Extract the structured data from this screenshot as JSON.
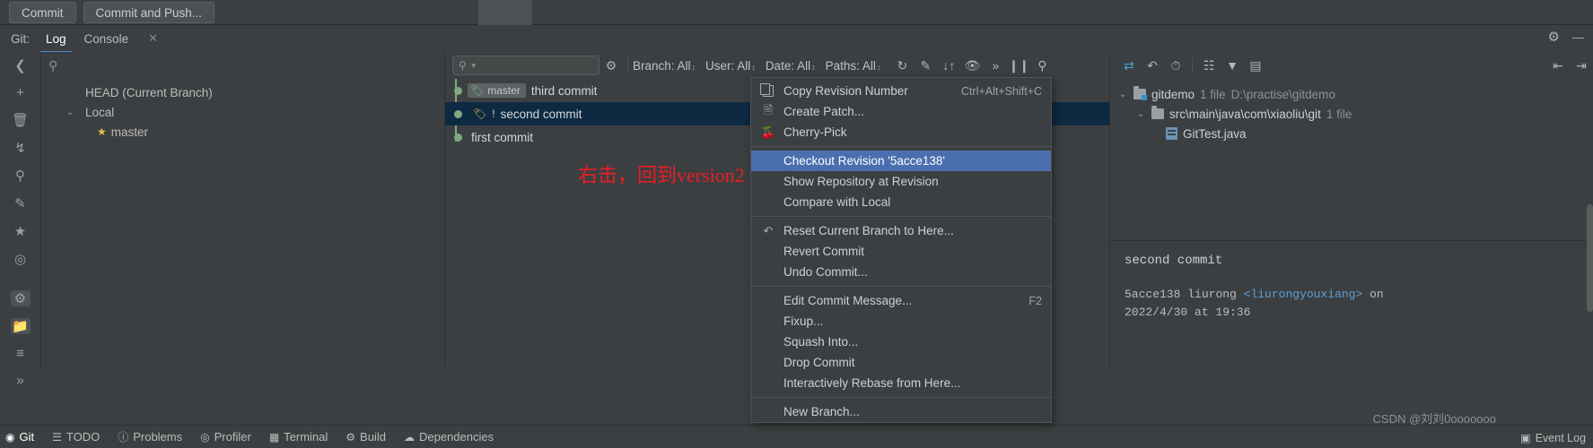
{
  "toolbar": {
    "commit_label": "Commit",
    "commit_push_label": "Commit and Push..."
  },
  "tabbar": {
    "git_label": "Git:",
    "log_tab": "Log",
    "console_tab": "Console",
    "close_glyph": "✕",
    "gear_glyph": "⚙",
    "minimize_glyph": "—"
  },
  "branches": {
    "search_placeholder": "",
    "items": [
      {
        "label": "HEAD (Current Branch)",
        "indent": 0,
        "chevron": ""
      },
      {
        "label": "Local",
        "indent": 0,
        "chevron": "⌄"
      },
      {
        "label": "master",
        "indent": 1,
        "chevron": ""
      }
    ]
  },
  "log_toolbar": {
    "search_placeholder": "",
    "search_glyph": "⌕",
    "gear_glyph": "⚙",
    "filters": [
      {
        "label": "Branch: All"
      },
      {
        "label": "User: All"
      },
      {
        "label": "Date: All"
      },
      {
        "label": "Paths: All"
      }
    ],
    "icons": [
      "refresh-icon",
      "paint-icon",
      "sort-icon",
      "eye-icon",
      "overflow-icon",
      "pause-icon",
      "find-icon"
    ],
    "overflow_glyph": "»"
  },
  "commits": [
    {
      "message": "third commit",
      "tag": "master",
      "tag_color": "#7cc47c",
      "selected": false,
      "has_bang": false
    },
    {
      "message": "second commit",
      "tag": "",
      "tag_color": "#e2c04a",
      "selected": true,
      "has_bang": true,
      "bang": "!"
    },
    {
      "message": "first commit",
      "tag": "",
      "tag_color": "",
      "selected": false,
      "has_bang": false
    }
  ],
  "annotation": {
    "text": "右击，回到version2",
    "color": "#ec1c24"
  },
  "context_menu": {
    "sections": [
      {
        "items": [
          {
            "label": "Copy Revision Number",
            "shortcut": "Ctrl+Alt+Shift+C",
            "icon": "copy-icon",
            "selected": false
          },
          {
            "label": "Create Patch...",
            "shortcut": "",
            "icon": "patch-icon",
            "selected": false
          },
          {
            "label": "Cherry-Pick",
            "shortcut": "",
            "icon": "cherry-pick-icon",
            "selected": false
          }
        ]
      },
      {
        "items": [
          {
            "label": "Checkout Revision '5acce138'",
            "shortcut": "",
            "icon": "",
            "selected": true
          },
          {
            "label": "Show Repository at Revision",
            "shortcut": "",
            "icon": "",
            "selected": false
          },
          {
            "label": "Compare with Local",
            "shortcut": "",
            "icon": "",
            "selected": false
          }
        ]
      },
      {
        "items": [
          {
            "label": "Reset Current Branch to Here...",
            "shortcut": "",
            "icon": "undo-icon",
            "selected": false
          },
          {
            "label": "Revert Commit",
            "shortcut": "",
            "icon": "",
            "selected": false
          },
          {
            "label": "Undo Commit...",
            "shortcut": "",
            "icon": "",
            "selected": false
          }
        ]
      },
      {
        "items": [
          {
            "label": "Edit Commit Message...",
            "shortcut": "F2",
            "icon": "",
            "selected": false
          },
          {
            "label": "Fixup...",
            "shortcut": "",
            "icon": "",
            "selected": false
          },
          {
            "label": "Squash Into...",
            "shortcut": "",
            "icon": "",
            "selected": false
          },
          {
            "label": "Drop Commit",
            "shortcut": "",
            "icon": "",
            "selected": false
          },
          {
            "label": "Interactively Rebase from Here...",
            "shortcut": "",
            "icon": "",
            "selected": false
          }
        ]
      },
      {
        "items": [
          {
            "label": "New Branch...",
            "shortcut": "",
            "icon": "",
            "selected": false
          }
        ]
      }
    ]
  },
  "changes_panel": {
    "tree": [
      {
        "label": "gitdemo",
        "count": "1 file",
        "path": "D:\\practise\\gitdemo",
        "level": 0,
        "chevron": "⌄",
        "kind": "root-folder"
      },
      {
        "label": "src\\main\\java\\com\\xiaoliu\\git",
        "count": "1 file",
        "path": "",
        "level": 1,
        "chevron": "⌄",
        "kind": "folder"
      },
      {
        "label": "GitTest.java",
        "count": "",
        "path": "",
        "level": 2,
        "chevron": "",
        "kind": "java-file"
      }
    ]
  },
  "commit_details": {
    "message": "second commit",
    "hash": "5acce138",
    "author": "liurong",
    "email": "<liurongyouxiang>",
    "on_word": "on",
    "date": "2022/4/30 at 19:36"
  },
  "statusbar": {
    "items": [
      {
        "label": "Git",
        "icon": "git-icon",
        "active": true
      },
      {
        "label": "TODO",
        "icon": "todo-icon",
        "active": false
      },
      {
        "label": "Problems",
        "icon": "problems-icon",
        "active": false
      },
      {
        "label": "Profiler",
        "icon": "profiler-icon",
        "active": false
      },
      {
        "label": "Terminal",
        "icon": "terminal-icon",
        "active": false
      },
      {
        "label": "Build",
        "icon": "build-icon",
        "active": false
      },
      {
        "label": "Dependencies",
        "icon": "dependencies-icon",
        "active": false
      }
    ],
    "event_log": "Event Log",
    "watermark": "CSDN @刘刘0ooooooo"
  }
}
